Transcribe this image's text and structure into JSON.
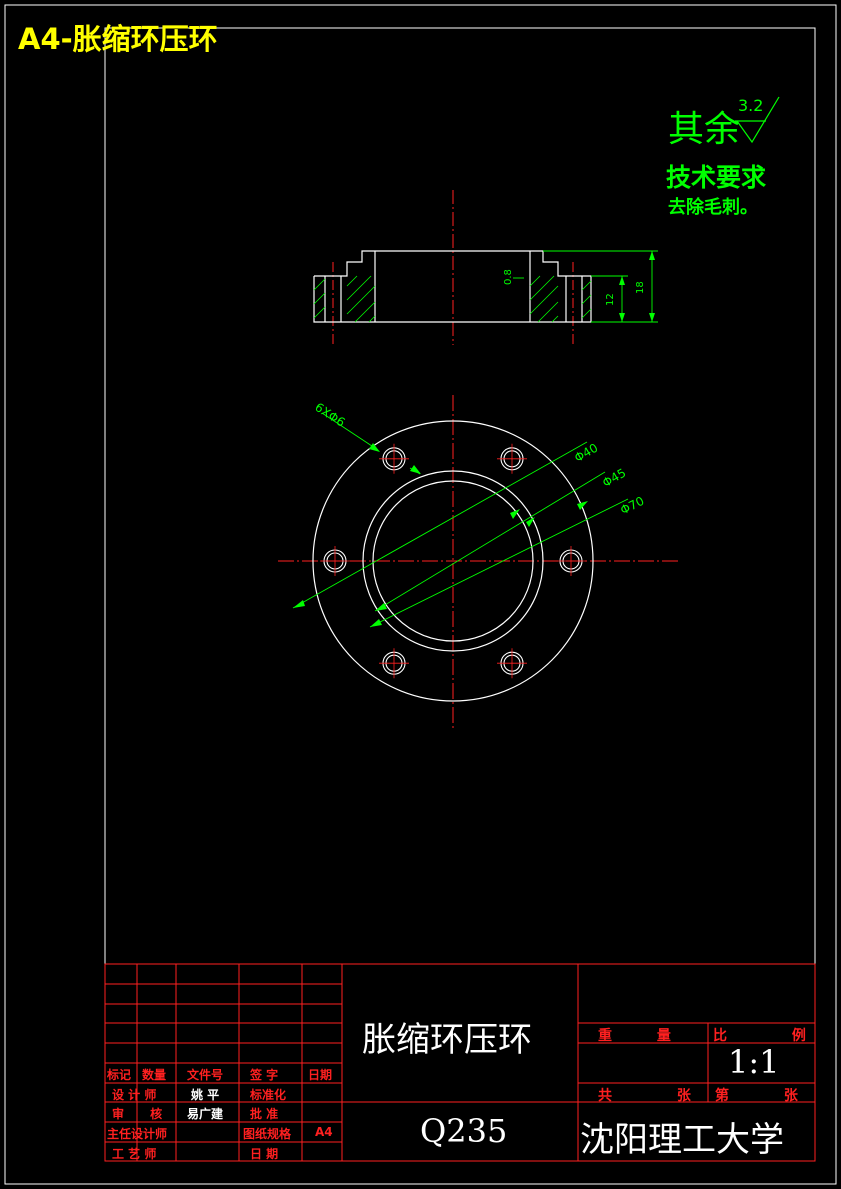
{
  "sheet_title": "A4-胀缩环压环",
  "surface_finish": {
    "prefix": "其余",
    "value": "3.2"
  },
  "tech_requirements": {
    "heading": "技术要求",
    "item": "去除毛刺。"
  },
  "section_view": {
    "roughness": "0.8",
    "dim_inner_height": "12",
    "dim_total_height": "18"
  },
  "plan_view": {
    "holes_label": "6XΦ6",
    "dia_1": "Φ40",
    "dia_2": "Φ45",
    "dia_3": "Φ70"
  },
  "title_block": {
    "part_name": "胀缩环压环",
    "material": "Q235",
    "organization": "沈阳理工大学",
    "scale": "1:1",
    "weight_label": "重 量",
    "ratio_label": "比 例",
    "total_label": "共 张",
    "sheet_label": "第 张",
    "rows": {
      "mark": "标记",
      "count": "数量",
      "file_no": "文件号",
      "signature": "签 字",
      "date": "日期",
      "designer": "设 计 师",
      "designer_name": "姚 平",
      "standardize": "标准化",
      "reviewer": "审 核",
      "reviewer_name": "易广建",
      "approve": "批 准",
      "chief_designer": "主任设计师",
      "paper_format": "图纸规格",
      "paper_size": "A4",
      "process_engineer": "工 艺 师",
      "date2": "日 期"
    }
  },
  "colors": {
    "line": "#ffffff",
    "frame": "#ffffff",
    "grid": "#ff2020",
    "dim": "#00ff00",
    "title": "#ffff00",
    "background": "#000000"
  }
}
